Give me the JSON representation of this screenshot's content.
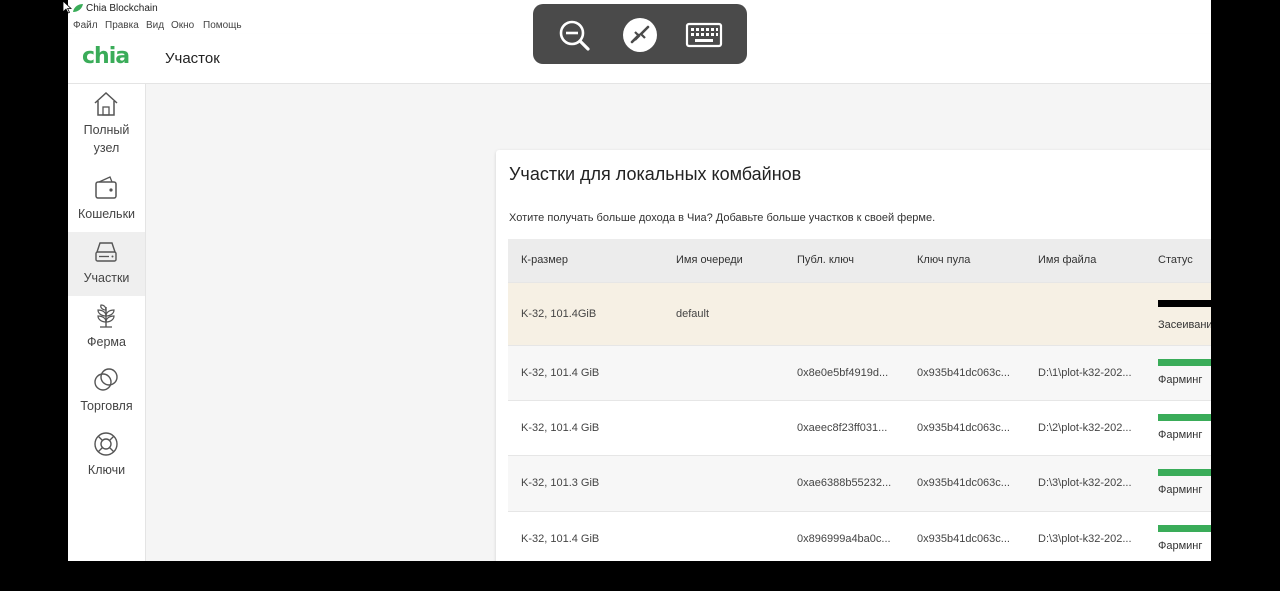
{
  "window": {
    "title": "Chia Blockchain"
  },
  "menu": [
    "Файл",
    "Правка",
    "Вид",
    "Окно",
    "Помощь"
  ],
  "header": {
    "logo": "chia",
    "page_title": "Участок"
  },
  "sidebar": {
    "items": [
      {
        "label": "Полный узел",
        "icon": "home-icon"
      },
      {
        "label": "Кошельки",
        "icon": "wallet-icon"
      },
      {
        "label": "Участки",
        "icon": "hard-drive-icon",
        "active": true
      },
      {
        "label": "Ферма",
        "icon": "plant-icon"
      },
      {
        "label": "Торговля",
        "icon": "trade-circles-icon"
      },
      {
        "label": "Ключи",
        "icon": "lifebuoy-icon"
      }
    ]
  },
  "card": {
    "title": "Участки для локальных комбайнов",
    "subtitle": "Хотите получать больше дохода в Чиа? Добавьте больше участков к своей ферме."
  },
  "table": {
    "columns": [
      "К-размер",
      "Имя очереди",
      "Публ. ключ",
      "Ключ пула",
      "Имя файла",
      "Статус"
    ],
    "rows": [
      {
        "size": "K-32, 101.4GiB",
        "queue": "default",
        "pubkey": "",
        "poolkey": "",
        "filename": "",
        "status": "Засеивани",
        "status_color": "#000000"
      },
      {
        "size": "K-32, 101.4 GiB",
        "queue": "",
        "pubkey": "0x8e0e5bf4919d...",
        "poolkey": "0x935b41dc063c...",
        "filename": "D:\\1\\plot-k32-202...",
        "status": "Фарминг",
        "status_color": "#3aac59"
      },
      {
        "size": "K-32, 101.4 GiB",
        "queue": "",
        "pubkey": "0xaeec8f23ff031...",
        "poolkey": "0x935b41dc063c...",
        "filename": "D:\\2\\plot-k32-202...",
        "status": "Фарминг",
        "status_color": "#3aac59"
      },
      {
        "size": "K-32, 101.3 GiB",
        "queue": "",
        "pubkey": "0xae6388b55232...",
        "poolkey": "0x935b41dc063c...",
        "filename": "D:\\3\\plot-k32-202...",
        "status": "Фарминг",
        "status_color": "#3aac59"
      },
      {
        "size": "K-32, 101.4 GiB",
        "queue": "",
        "pubkey": "0x896999a4ba0c...",
        "poolkey": "0x935b41dc063c...",
        "filename": "D:\\3\\plot-k32-202...",
        "status": "Фарминг",
        "status_color": "#3aac59"
      }
    ]
  },
  "remote_toolbar": {
    "buttons": [
      "zoom-out-icon",
      "remote-connect-icon",
      "keyboard-icon"
    ]
  },
  "colors": {
    "accent": "#3aac59",
    "toolbar_bg": "#4a4a4a"
  }
}
